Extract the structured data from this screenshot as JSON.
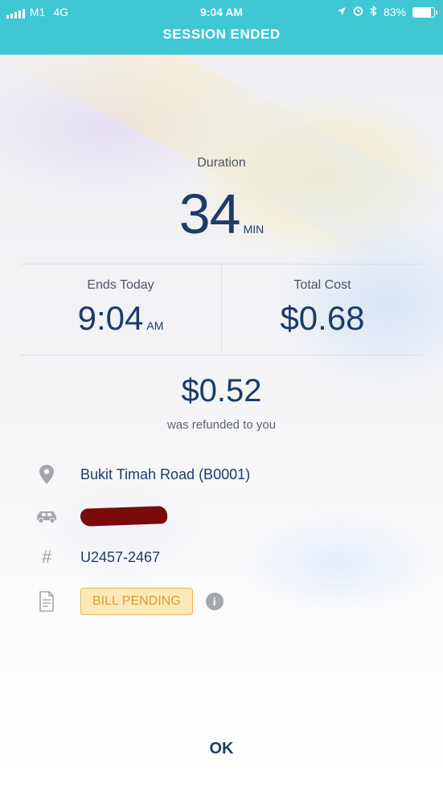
{
  "status_bar": {
    "carrier": "M1",
    "network": "4G",
    "time": "9:04 AM",
    "battery": "83%",
    "battery_level": 0.83
  },
  "header": {
    "title": "SESSION ENDED"
  },
  "duration": {
    "label": "Duration",
    "value": "34",
    "unit": "MIN"
  },
  "ends": {
    "label": "Ends Today",
    "value": "9:04",
    "unit": "AM"
  },
  "total_cost": {
    "label": "Total Cost",
    "value": "$0.68"
  },
  "refund": {
    "amount": "$0.52",
    "note": "was refunded to you"
  },
  "details": {
    "location": "Bukit Timah Road (B0001)",
    "session_id": "U2457-2467",
    "bill_status": "BILL PENDING"
  },
  "footer": {
    "ok_label": "OK"
  }
}
